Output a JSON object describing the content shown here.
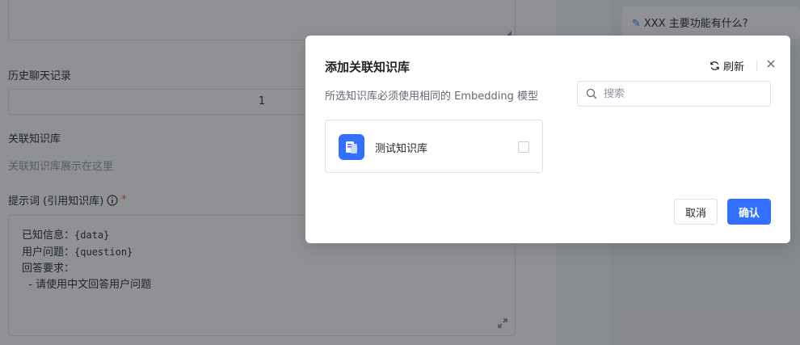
{
  "form": {
    "history_label": "历史聊天记录",
    "history_value": "1",
    "knowledge_label": "关联知识库",
    "knowledge_placeholder": "关联知识库展示在这里",
    "prompt_label": "提示词 (引用知识库)",
    "prompt_required": "*",
    "prompt_lines": [
      "已知信息：",
      "用户问题：",
      "回答要求：",
      "  - 请使用中文回答用户问题"
    ],
    "prompt_vars": [
      "{data}",
      "{question}"
    ]
  },
  "right_panel": {
    "suggested_question": "XXX 主要功能有什么?"
  },
  "dialog": {
    "title": "添加关联知识库",
    "refresh_label": "刷新",
    "description": "所选知识库必须使用相同的 Embedding 模型",
    "search_placeholder": "搜索",
    "knowledge_bases": [
      {
        "name": "测试知识库",
        "checked": false
      }
    ],
    "cancel_label": "取消",
    "confirm_label": "确认"
  },
  "colors": {
    "primary": "#3370ff",
    "required": "#f54a45",
    "overlay": "rgba(31,35,41,0.5)"
  }
}
